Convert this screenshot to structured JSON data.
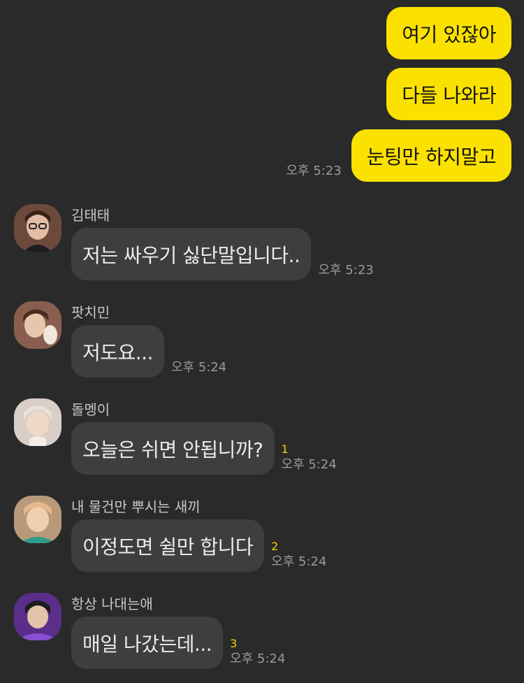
{
  "outgoing": [
    {
      "text": "여기 있잖아",
      "time": ""
    },
    {
      "text": "다들 나와라",
      "time": ""
    },
    {
      "text": "눈팅만 하지말고",
      "time": "오후 5:23"
    }
  ],
  "incoming": [
    {
      "sender": "김태태",
      "text": "저는 싸우기 싫단말입니다..",
      "unread": "",
      "time": "오후 5:23",
      "avatar_color": "#6b4a3c"
    },
    {
      "sender": "팟치민",
      "text": "저도요...",
      "unread": "",
      "time": "오후 5:24",
      "avatar_color": "#8a5e4e"
    },
    {
      "sender": "돌멩이",
      "text": "오늘은 쉬면 안됩니까?",
      "unread": "1",
      "time": "오후 5:24",
      "avatar_color": "#d9cfc8"
    },
    {
      "sender": "내 물건만 뿌시는 새끼",
      "text": "이정도면 쉴만 합니다",
      "unread": "2",
      "time": "오후 5:24",
      "avatar_color": "#b89a7a"
    },
    {
      "sender": "항상 나대는애",
      "text": "매일 나갔는데...",
      "unread": "3",
      "time": "오후 5:24",
      "avatar_color": "#5a2e8a"
    }
  ],
  "colors": {
    "background": "#2a2a2b",
    "my_bubble": "#fae100",
    "their_bubble": "#3e3e40",
    "unread_count": "#f2d300"
  }
}
